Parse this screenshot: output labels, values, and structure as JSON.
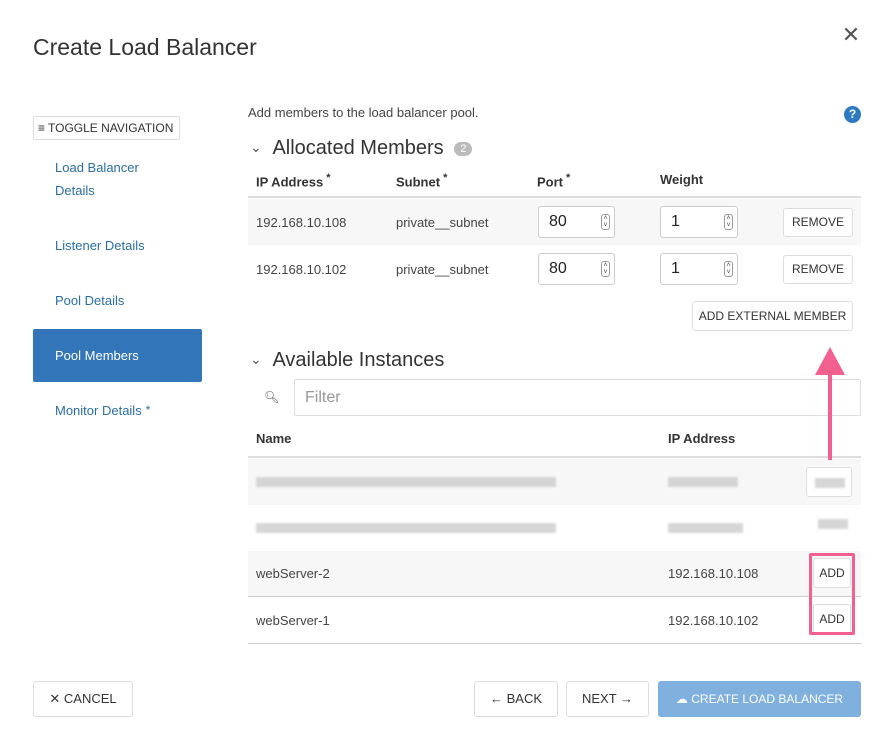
{
  "dialog": {
    "title": "Create Load Balancer",
    "close_glyph": "✕"
  },
  "sidebar": {
    "toggle_label": "TOGGLE NAVIGATION",
    "items": [
      {
        "label_line1": "Load Balancer",
        "label_line2": "Details"
      },
      {
        "label": "Listener Details"
      },
      {
        "label": "Pool Details"
      },
      {
        "label": "Pool Members",
        "active": true
      },
      {
        "label": "Monitor Details",
        "required_mark": "*"
      }
    ]
  },
  "main": {
    "intro": "Add members to the load balancer pool.",
    "help_glyph": "?",
    "allocated": {
      "title": "Allocated Members",
      "count": "2",
      "headers": {
        "ip": "IP Address",
        "subnet": "Subnet",
        "port": "Port",
        "weight": "Weight",
        "required_mark": "*"
      },
      "rows": [
        {
          "ip": "192.168.10.108",
          "subnet": "private__subnet",
          "port": "80",
          "weight": "1",
          "remove": "REMOVE"
        },
        {
          "ip": "192.168.10.102",
          "subnet": "private__subnet",
          "port": "80",
          "weight": "1",
          "remove": "REMOVE"
        }
      ],
      "add_external": "ADD EXTERNAL MEMBER"
    },
    "available": {
      "title": "Available Instances",
      "filter_placeholder": "Filter",
      "headers": {
        "name": "Name",
        "ip": "IP Address"
      },
      "rows": [
        {
          "name": "webServer-2",
          "ip": "192.168.10.108",
          "action": "ADD"
        },
        {
          "name": "webServer-1",
          "ip": "192.168.10.102",
          "action": "ADD"
        }
      ]
    }
  },
  "footer": {
    "cancel": "✕ CANCEL",
    "back": "← BACK",
    "next": "NEXT →",
    "create": "☁ CREATE LOAD BALANCER"
  },
  "colors": {
    "accent": "#3275b8",
    "link": "#2a6ea6",
    "annotation": "#f2608f",
    "primary_disabled": "#7fb0de"
  }
}
